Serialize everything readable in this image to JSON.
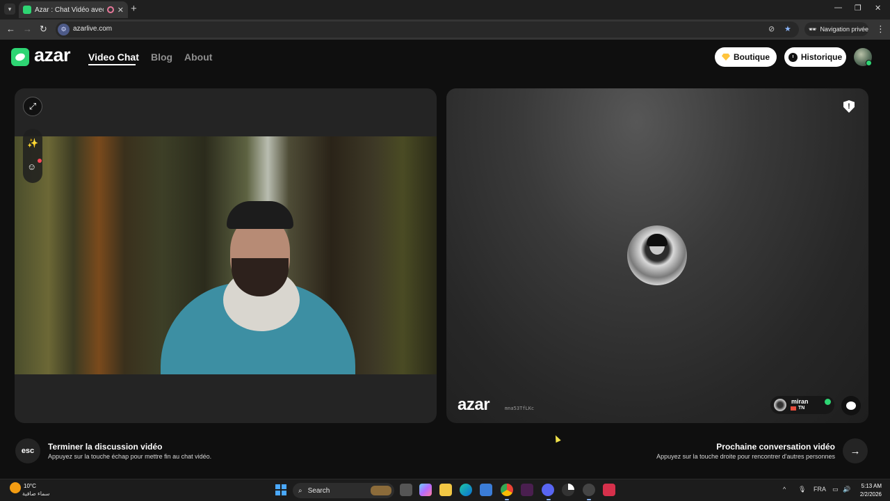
{
  "browser": {
    "tab_title": "Azar : Chat Vidéo avec de n",
    "tab_close": "✕",
    "new_tab": "+",
    "url": "azarlive.com",
    "incognito_label": "Navigation privée",
    "icons": [
      "back-icon",
      "forward-icon",
      "reload-icon",
      "eye-off-icon",
      "star-icon",
      "incognito-icon",
      "menu-dots-icon"
    ]
  },
  "header": {
    "logo_text": "azar",
    "nav": [
      {
        "label": "Video Chat",
        "active": true
      },
      {
        "label": "Blog",
        "active": false
      },
      {
        "label": "About",
        "active": false
      }
    ],
    "shop_label": "Boutique",
    "history_label": "Historique"
  },
  "remote": {
    "watermark_logo": "azar",
    "watermark_id": "mna53TfLKc",
    "peer_name": "miran",
    "peer_country": "TN"
  },
  "hints": {
    "esc_key": "esc",
    "end_title": "Terminer la discussion vidéo",
    "end_sub": "Appuyez sur la touche échap pour mettre fin au chat vidéo.",
    "next_title": "Prochaine conversation vidéo",
    "next_sub": "Appuyez sur la touche droite pour rencontrer d'autres personnes"
  },
  "taskbar": {
    "temperature": "10°C",
    "weather_desc": "سماء صافية",
    "search_label": "Search",
    "language": "FRA",
    "time": "5:13 AM",
    "date": "2/2/2026"
  },
  "colors": {
    "brand": "#2ed573",
    "gem": "#ffc43d",
    "panel": "#242424"
  }
}
